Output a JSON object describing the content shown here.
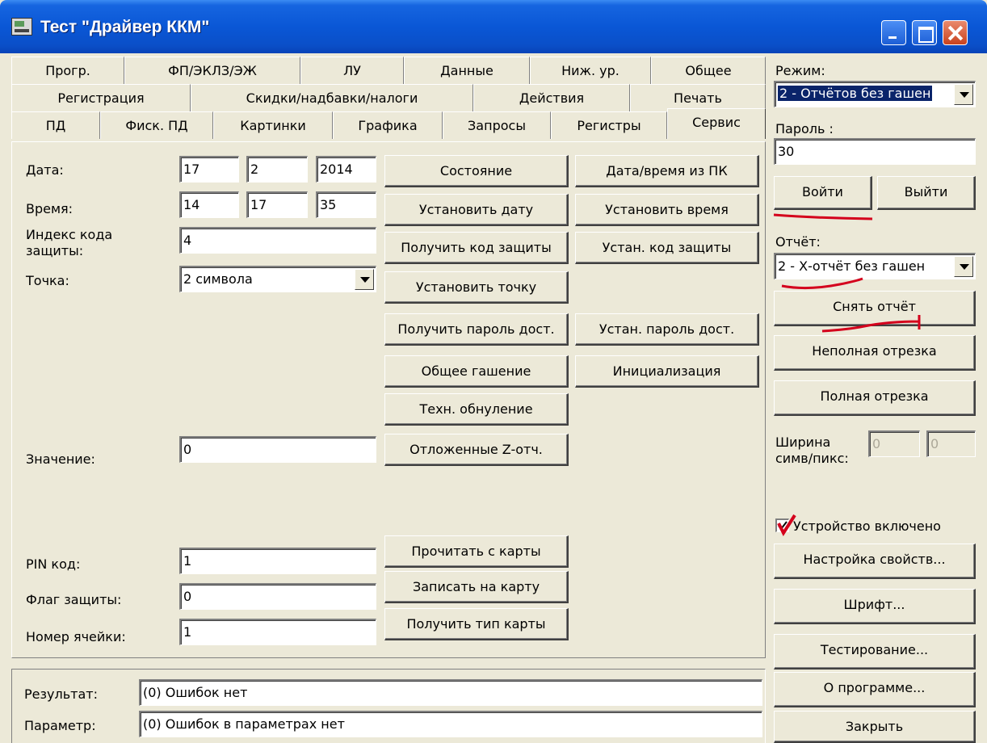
{
  "window": {
    "title": "Тест \"Драйвер ККМ\""
  },
  "tabs": {
    "row1": [
      "Прогр.",
      "ФП/ЭКЛЗ/ЭЖ",
      "ЛУ",
      "Данные",
      "Ниж. ур.",
      "Общее"
    ],
    "row2": [
      "Регистрация",
      "Скидки/надбавки/налоги",
      "Действия",
      "Печать"
    ],
    "row3": [
      "ПД",
      "Фиск. ПД",
      "Картинки",
      "Графика",
      "Запросы",
      "Регистры",
      "Сервис"
    ],
    "selected": "Сервис"
  },
  "service": {
    "date_label": "Дата:",
    "date_day": "17",
    "date_month": "2",
    "date_year": "2014",
    "time_label": "Время:",
    "time_h": "14",
    "time_m": "17",
    "time_s": "35",
    "code_index_label": "Индекс кода защиты:",
    "code_index_label_line1": "Индекс кода",
    "code_index_label_line2": "защиты:",
    "code_index_value": "4",
    "point_label": "Точка:",
    "point_value": "2 символа",
    "value_label": "Значение:",
    "value_value": "0",
    "pin_label": "PIN код:",
    "pin_value": "1",
    "flag_label": "Флаг защиты:",
    "flag_value": "0",
    "cell_label": "Номер ячейки:",
    "cell_value": "1",
    "buttons": {
      "status": "Состояние",
      "datetime_pc": "Дата/время из ПК",
      "set_date": "Установить дату",
      "set_time": "Установить время",
      "get_code": "Получить код защиты",
      "set_code": "Устан. код защиты",
      "set_point": "Установить точку",
      "get_password": "Получить пароль дост.",
      "set_password": "Устан. пароль дост.",
      "general_clear": "Общее гашение",
      "init": "Инициализация",
      "tech_reset": "Техн. обнуление",
      "delayed_z": "Отложенные Z-отч.",
      "read_card": "Прочитать с карты",
      "write_card": "Записать на карту",
      "card_type": "Получить тип карты"
    }
  },
  "result": {
    "result_label": "Результат:",
    "result_value": "(0) Ошибок нет",
    "param_label": "Параметр:",
    "param_value": "(0) Ошибок в параметрах нет"
  },
  "side": {
    "mode_label": "Режим:",
    "mode_value": "2 - Отчётов без гашен",
    "password_label": "Пароль :",
    "password_value": "30",
    "login": "Войти",
    "logout": "Выйти",
    "report_label": "Отчёт:",
    "report_value": "2 - Х-отчёт без гашен",
    "take_report": "Снять отчёт",
    "partial_cut": "Неполная отрезка",
    "full_cut": "Полная отрезка",
    "width_label_line1": "Ширина",
    "width_label_line2": "симв/пикс:",
    "width_chars": "0",
    "width_pixels": "0",
    "device_on": "Устройство включено",
    "device_on_checked": true,
    "properties": "Настройка свойств...",
    "font": "Шрифт...",
    "testing": "Тестирование...",
    "about": "О программе...",
    "close": "Закрыть"
  },
  "colors": {
    "titlebar": "#0a57d6",
    "face": "#ece9d8",
    "annotation": "#d4001c"
  }
}
